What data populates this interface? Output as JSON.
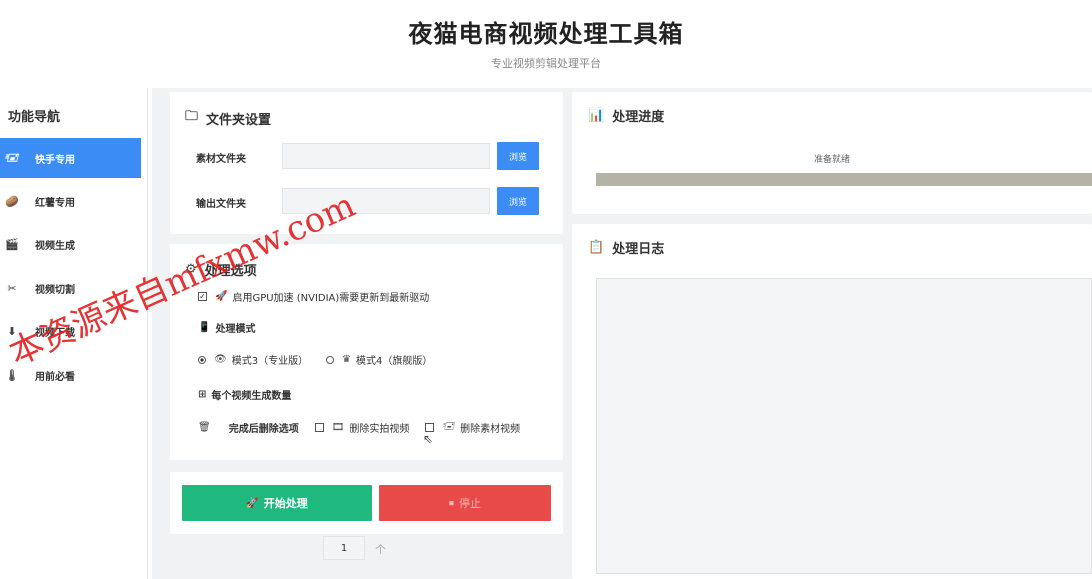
{
  "header": {
    "title": "夜猫电商视频处理工具箱",
    "subtitle": "专业视频剪辑处理平台"
  },
  "sidebar": {
    "title": "功能导航",
    "items": [
      {
        "label": "快手专用",
        "icon": "🖅",
        "active": true
      },
      {
        "label": "红薯专用",
        "icon": "🥔",
        "active": false
      },
      {
        "label": "视频生成",
        "icon": "🎬",
        "active": false
      },
      {
        "label": "视频切割",
        "icon": "✂",
        "active": false
      },
      {
        "label": "视频下载",
        "icon": "⬇",
        "active": false
      },
      {
        "label": "用前必看",
        "icon": "🌡",
        "active": false
      }
    ]
  },
  "folder": {
    "title": "文件夹设置",
    "icon": "🗀",
    "source_label": "素材文件夹",
    "source_value": "",
    "output_label": "输出文件夹",
    "output_value": "",
    "browse_label": "浏览"
  },
  "options": {
    "title": "处理选项",
    "icon": "⚙",
    "gpu_label": "启用GPU加速 (NVIDIA)需要更新到最新驱动",
    "gpu_checked": true,
    "mode_title": "处理模式",
    "mode3_label": "模式3（专业版）",
    "mode4_label": "模式4（旗舰版）",
    "selected_mode": "mode3",
    "count_label": "每个视频生成数量",
    "count_value": "1",
    "count_arrow": "个",
    "delete_title": "完成后删除选项",
    "delete_real_label": "删除实拍视频",
    "delete_material_label": "删除素材视频"
  },
  "actions": {
    "start_label": "开始处理",
    "stop_label": "停止"
  },
  "progress": {
    "title": "处理进度",
    "status": "准备就绪",
    "percent": 100
  },
  "log": {
    "title": "处理日志",
    "content": ""
  },
  "watermark": "本资源来自mfxmw.com",
  "colors": {
    "accent": "#3b8df5",
    "start": "#1fb97f",
    "stop": "#e84a4a"
  }
}
